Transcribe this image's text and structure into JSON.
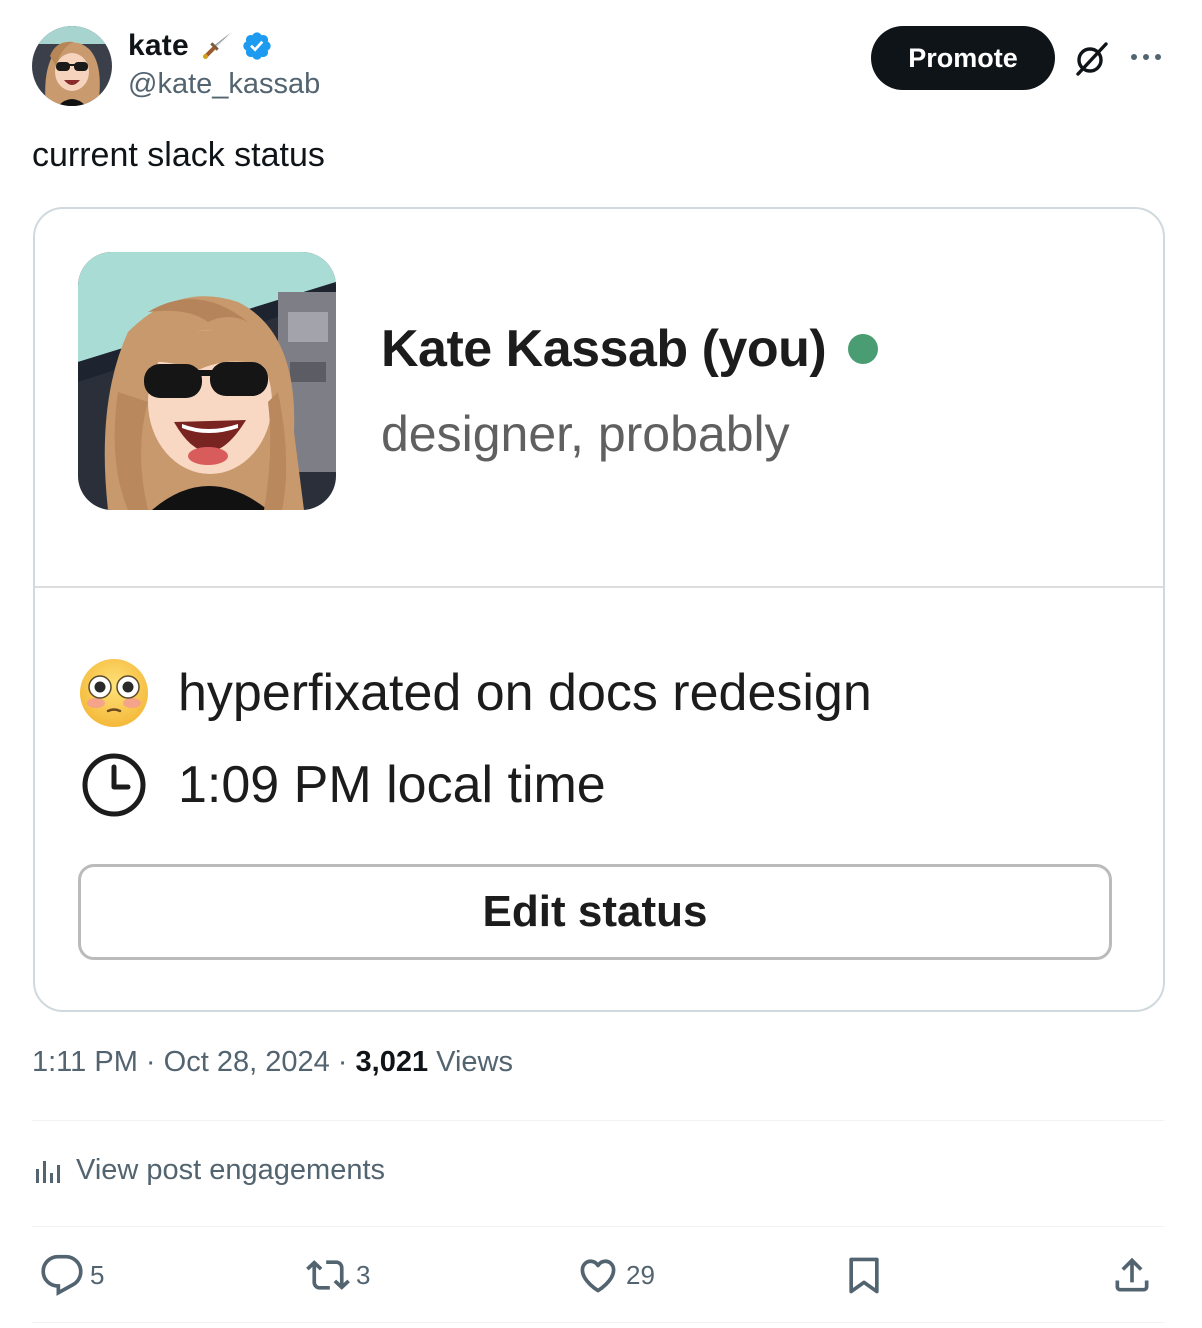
{
  "tweet": {
    "author": {
      "display_name": "kate",
      "handle": "@kate_kassab",
      "verified": true,
      "emoji_badge": "dagger-icon"
    },
    "promote_label": "Promote",
    "text": "current slack status",
    "meta": {
      "time": "1:11 PM",
      "separator": "·",
      "date": "Oct 28, 2024",
      "views_count": "3,021",
      "views_label": "Views"
    },
    "engagements_label": "View post engagements",
    "actions": {
      "reply_count": "5",
      "repost_count": "3",
      "like_count": "29"
    }
  },
  "slack_card": {
    "name": "Kate Kassab (you)",
    "title": "designer, probably",
    "presence_color": "#4a9d72",
    "status_emoji": "flushed-face-icon",
    "status_text": "hyperfixated on docs redesign",
    "local_time": "1:09 PM local time",
    "edit_status_label": "Edit status"
  },
  "colors": {
    "text_primary": "#0f1419",
    "text_secondary": "#536471",
    "verified_blue": "#1d9bf0",
    "promote_bg": "#0f1419"
  }
}
